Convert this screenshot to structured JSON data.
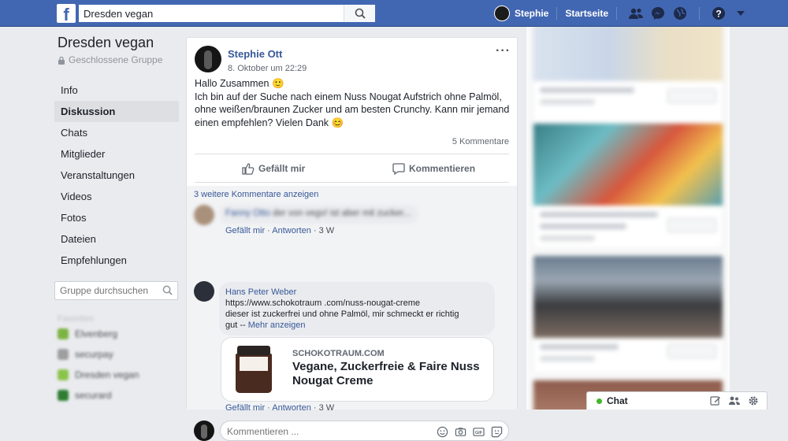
{
  "topbar": {
    "logo": "f",
    "search_value": "Dresden vegan",
    "user_name": "Stephie",
    "home_label": "Startseite",
    "icons": [
      "friends-icon",
      "messenger-icon",
      "globe-icon",
      "help-icon",
      "caret-down-icon"
    ]
  },
  "group": {
    "name": "Dresden vegan",
    "privacy": "Geschlossene Gruppe",
    "nav": [
      {
        "label": "Info",
        "active": false
      },
      {
        "label": "Diskussion",
        "active": true
      },
      {
        "label": "Chats",
        "active": false
      },
      {
        "label": "Mitglieder",
        "active": false
      },
      {
        "label": "Veranstaltungen",
        "active": false
      },
      {
        "label": "Videos",
        "active": false
      },
      {
        "label": "Fotos",
        "active": false
      },
      {
        "label": "Dateien",
        "active": false
      },
      {
        "label": "Empfehlungen",
        "active": false
      }
    ],
    "search_placeholder": "Gruppe durchsuchen",
    "favorites_label": "Favoriten",
    "favorites": [
      {
        "label": "Elvenberg",
        "color": "#7cb342"
      },
      {
        "label": "securpay",
        "color": "#9e9e9e"
      },
      {
        "label": "Dresden vegan",
        "color": "#8bc34a"
      },
      {
        "label": "securard",
        "color": "#2e7d32"
      }
    ]
  },
  "post": {
    "author": "Stephie Ott",
    "timestamp": "8. Oktober um 22:29",
    "text": "Hallo Zusammen 🙂\nIch bin auf der Suche nach einem Nuss Nougat Aufstrich ohne Palmöl,\nohne weißen/braunen Zucker und am besten Crunchy. Kann mir jemand\neinen empfehlen? Vielen Dank 😊",
    "comment_count": "5 Kommentare",
    "like_label": "Gefällt mir",
    "comment_label": "Kommentieren",
    "more_comments": "3 weitere Kommentare anzeigen"
  },
  "comments": [
    {
      "author": "Fanny Otto",
      "text": "der von vego! ist aber mit zucker...",
      "like": "Gefällt mir",
      "reply": "Antworten",
      "age": "3 W"
    },
    {
      "author": "Hans Peter Weber",
      "url": "https://www.schokotraum .com/nuss-nougat-creme",
      "text": "dieser ist zuckerfrei und ohne Palmöl, mir schmeckt er richtig",
      "text2": "gut --",
      "more": "Mehr anzeigen",
      "like": "Gefällt mir",
      "reply": "Antworten",
      "age": "3 W",
      "link": {
        "domain": "SCHOKOTRAUM.COM",
        "title": "Vegane, Zuckerfreie & Faire Nuss Nougat Creme"
      }
    }
  ],
  "compose": {
    "placeholder": "Kommentieren ..."
  },
  "chat": {
    "label": "Chat",
    "status_color": "#42b72a"
  },
  "colors": {
    "brand": "#4267b2",
    "link": "#365899"
  }
}
